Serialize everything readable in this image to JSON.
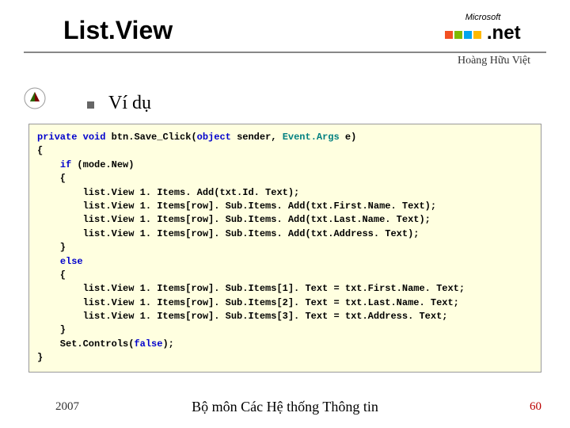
{
  "title": "List.View",
  "logo": {
    "company": "Microsoft",
    "product": ".net"
  },
  "author": "Hoàng Hữu Việt",
  "section_title": "Ví dụ",
  "code": {
    "tokens": [
      {
        "t": "kw",
        "v": "private"
      },
      {
        "t": "pln",
        "v": " "
      },
      {
        "t": "kw",
        "v": "void"
      },
      {
        "t": "pln",
        "v": " btn.Save_Click("
      },
      {
        "t": "kw",
        "v": "object"
      },
      {
        "t": "pln",
        "v": " sender, "
      },
      {
        "t": "typ",
        "v": "Event.Args"
      },
      {
        "t": "pln",
        "v": " e)"
      },
      {
        "t": "nl"
      },
      {
        "t": "pln",
        "v": "{"
      },
      {
        "t": "nl"
      },
      {
        "t": "pln",
        "v": "    "
      },
      {
        "t": "kw",
        "v": "if"
      },
      {
        "t": "pln",
        "v": " (mode.New)"
      },
      {
        "t": "nl"
      },
      {
        "t": "pln",
        "v": "    {"
      },
      {
        "t": "nl"
      },
      {
        "t": "pln",
        "v": "        list.View 1. Items. Add(txt.Id. Text);"
      },
      {
        "t": "nl"
      },
      {
        "t": "pln",
        "v": "        list.View 1. Items[row]. Sub.Items. Add(txt.First.Name. Text);"
      },
      {
        "t": "nl"
      },
      {
        "t": "pln",
        "v": "        list.View 1. Items[row]. Sub.Items. Add(txt.Last.Name. Text);"
      },
      {
        "t": "nl"
      },
      {
        "t": "pln",
        "v": "        list.View 1. Items[row]. Sub.Items. Add(txt.Address. Text);"
      },
      {
        "t": "nl"
      },
      {
        "t": "pln",
        "v": "    }"
      },
      {
        "t": "nl"
      },
      {
        "t": "pln",
        "v": "    "
      },
      {
        "t": "kw",
        "v": "else"
      },
      {
        "t": "nl"
      },
      {
        "t": "pln",
        "v": "    {"
      },
      {
        "t": "nl"
      },
      {
        "t": "pln",
        "v": "        list.View 1. Items[row]. Sub.Items[1]. Text = txt.First.Name. Text;"
      },
      {
        "t": "nl"
      },
      {
        "t": "pln",
        "v": "        list.View 1. Items[row]. Sub.Items[2]. Text = txt.Last.Name. Text;"
      },
      {
        "t": "nl"
      },
      {
        "t": "pln",
        "v": "        list.View 1. Items[row]. Sub.Items[3]. Text = txt.Address. Text;"
      },
      {
        "t": "nl"
      },
      {
        "t": "pln",
        "v": "    }"
      },
      {
        "t": "nl"
      },
      {
        "t": "pln",
        "v": "    Set.Controls("
      },
      {
        "t": "kw",
        "v": "false"
      },
      {
        "t": "pln",
        "v": ");"
      },
      {
        "t": "nl"
      },
      {
        "t": "pln",
        "v": "}"
      }
    ]
  },
  "footer": {
    "year": "2007",
    "department": "Bộ môn Các Hệ thống Thông tin",
    "page": "60"
  }
}
